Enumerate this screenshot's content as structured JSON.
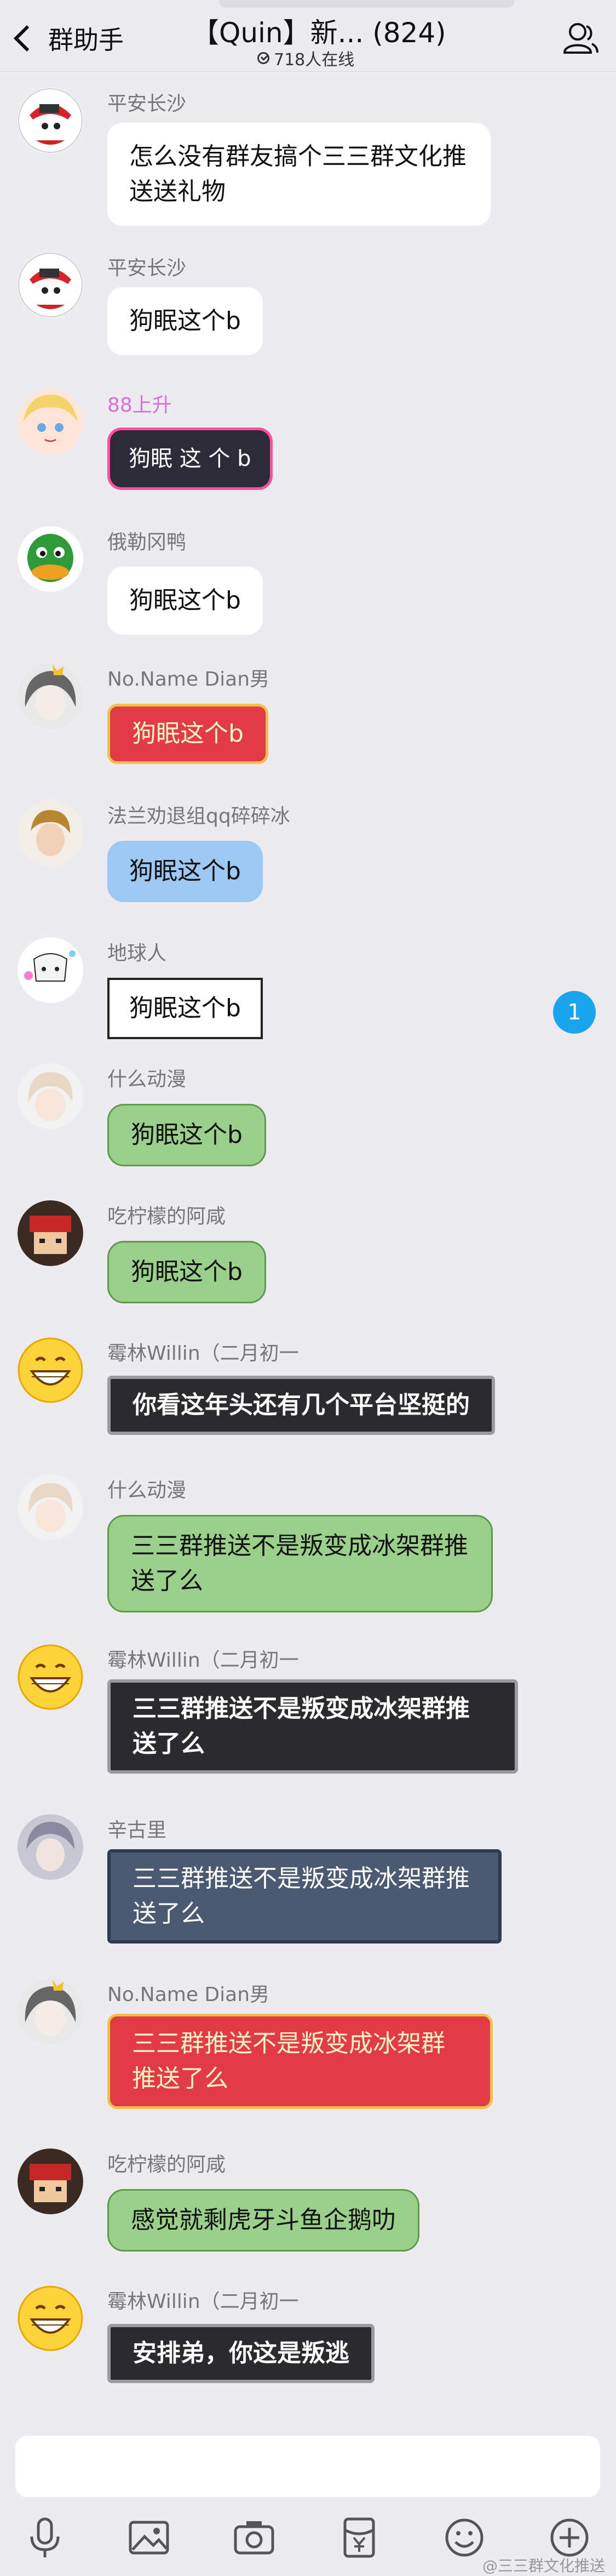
{
  "header": {
    "back_label": "群助手",
    "title": "【Quin】新... (824)",
    "online": "718人在线"
  },
  "messages": [
    {
      "sender": "平安长沙",
      "text": "怎么没有群友搞个三三群文化推送送礼物"
    },
    {
      "sender": "平安长沙",
      "text": "狗眠这个b"
    },
    {
      "sender": "88上升",
      "text": "狗眠 这 个 b"
    },
    {
      "sender": "俄勒冈鸭",
      "text": "狗眠这个b"
    },
    {
      "sender": "No.Name   Dian男",
      "text": "狗眠这个b"
    },
    {
      "sender": "法兰劝退组qq碎碎冰",
      "text": "狗眠这个b"
    },
    {
      "sender": "地球人",
      "text": "狗眠这个b"
    },
    {
      "sender": "什么动漫",
      "text": "狗眠这个b"
    },
    {
      "sender": "吃柠檬的阿咸",
      "text": "狗眠这个b"
    },
    {
      "sender": "霉林Willin（二月初一",
      "text": "你看这年头还有几个平台坚挺的"
    },
    {
      "sender": "什么动漫",
      "text": "三三群推送不是叛变成冰架群推送了么"
    },
    {
      "sender": "霉林Willin（二月初一",
      "text": "三三群推送不是叛变成冰架群推送了么"
    },
    {
      "sender": "辛古里",
      "text": "三三群推送不是叛变成冰架群推送了么"
    },
    {
      "sender": "No.Name   Dian男",
      "text": "三三群推送不是叛变成冰架群推送了么"
    },
    {
      "sender": "吃柠檬的阿咸",
      "text": "感觉就剩虎牙斗鱼企鹅叻"
    },
    {
      "sender": "霉林Willin（二月初一",
      "text": "安排弟，你这是叛逃"
    }
  ],
  "unread_count": "1",
  "toolbar": {
    "icons": [
      "microphone-icon",
      "image-icon",
      "camera-icon",
      "red-packet-icon",
      "emoji-icon",
      "plus-icon"
    ]
  },
  "watermark": "@三三群文化推送",
  "colors": {
    "accent_blue": "#19a4ee",
    "background": "#ebebf0"
  }
}
